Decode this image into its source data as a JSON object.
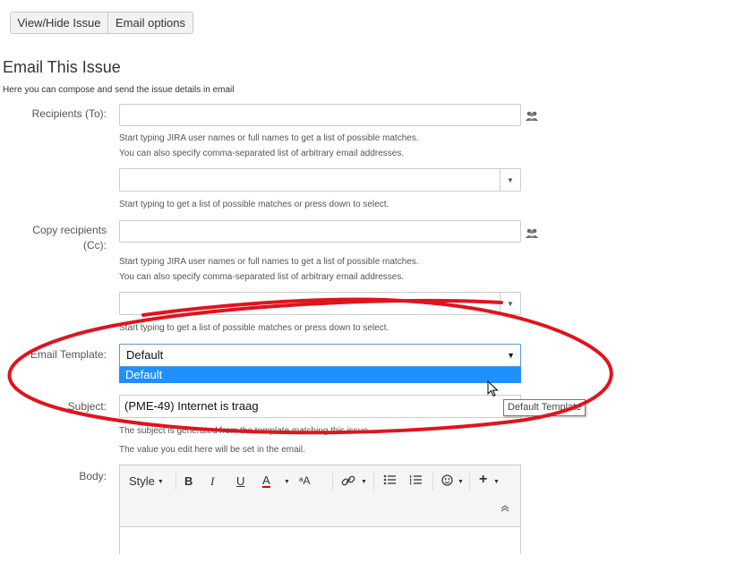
{
  "toolbar": {
    "view_hide": "View/Hide Issue",
    "email_options": "Email options"
  },
  "page": {
    "title": "Email This Issue",
    "intro": "Here you can compose and send the issue details in email"
  },
  "recipients_to": {
    "label": "Recipients (To):",
    "hint1": "Start typing JIRA user names or full names to get a list of possible matches.",
    "hint2": "You can also specify comma-separated list of arbitrary email addresses.",
    "select_hint": "Start typing to get a list of possible matches or press down to select."
  },
  "recipients_cc": {
    "label_line1": "Copy recipients",
    "label_line2": "(Cc):",
    "hint1": "Start typing JIRA user names or full names to get a list of possible matches.",
    "hint2": "You can also specify comma-separated list of arbitrary email addresses.",
    "select_hint": "Start typing to get a list of possible matches or press down to select."
  },
  "template": {
    "label": "Email Template:",
    "value": "Default",
    "options": [
      "Default"
    ],
    "tooltip": "Default Template"
  },
  "subject": {
    "label": "Subject:",
    "value": "(PME-49) Internet is traag",
    "hint1": "The subject is generated from the template matching this issue.",
    "hint2": "The value you edit here will be set in the email."
  },
  "body": {
    "label": "Body:",
    "style_label": "Style",
    "bold": "B",
    "italic": "I",
    "underline": "U",
    "color": "A",
    "size": "ᵃA"
  },
  "colors": {
    "annotation": "#e0141e",
    "selected": "#1e90ff",
    "text_color_bar": "#d0021b"
  },
  "icons": [
    "people-icon",
    "chevron-down-icon",
    "link-icon",
    "bullet-list-icon",
    "numbered-list-icon",
    "emoticon-icon",
    "plus-icon",
    "collapse-icon",
    "mouse-cursor-icon"
  ]
}
